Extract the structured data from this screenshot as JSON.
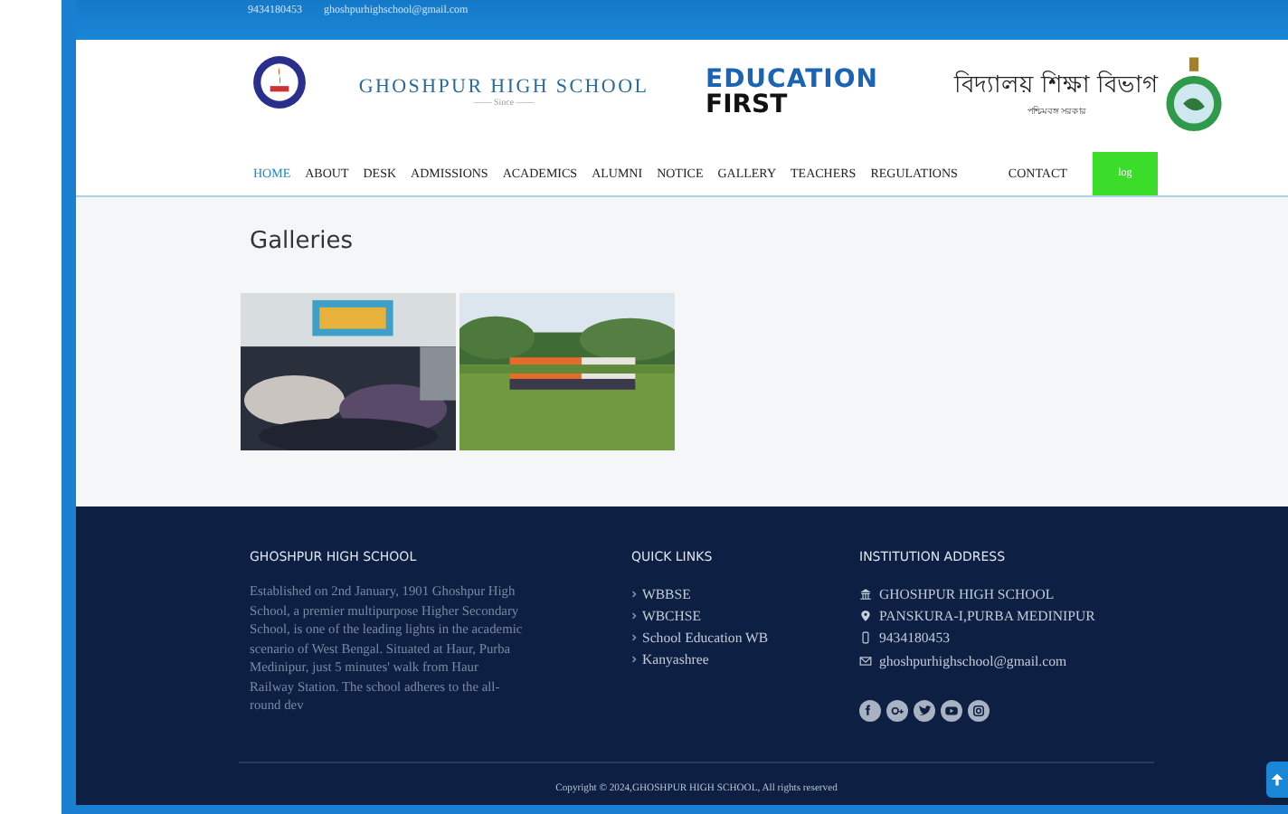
{
  "topbar": {
    "phone": "9434180453",
    "email": "ghoshpurhighschool@gmail.com"
  },
  "header": {
    "school_name": "GHOSHPUR HIGH SCHOOL",
    "since": "—— Since ——",
    "slogan_1": "EDUCATION",
    "slogan_2": "FIRST",
    "dept_name": "বিদ্যালয় শিক্ষা বিভাগ",
    "dept_sub": "পশ্চিমবঙ্গ সরকার"
  },
  "nav": [
    {
      "label": "HOME",
      "selected": true
    },
    {
      "label": "ABOUT",
      "selected": false
    },
    {
      "label": "DESK",
      "selected": false
    },
    {
      "label": "ADMISSIONS",
      "selected": false
    },
    {
      "label": "ACADEMICS",
      "selected": false
    },
    {
      "label": "ALUMNI",
      "selected": false
    },
    {
      "label": "NOTICE",
      "selected": false
    },
    {
      "label": "GALLERY",
      "selected": false
    },
    {
      "label": "TEACHERS",
      "selected": false
    },
    {
      "label": "REGULATIONS",
      "selected": false
    },
    {
      "label": "CONTACT",
      "selected": false
    }
  ],
  "login_button": "log",
  "page_title": "Galleries",
  "footer": {
    "about_title": "GHOSHPUR HIGH SCHOOL",
    "about_text": "Established on 2nd January, 1901 Ghoshpur High School, a premier multipurpose Higher Secondary School, is one of the leading lights in the academic scenario of West Bengal. Situated at Haur, Purba Medinipur, just 5 minutes' walk from Haur Railway Station. The school adheres to the all-round dev",
    "links_title": "QUICK LINKS",
    "links": [
      "WBBSE",
      "WBCHSE",
      "School Education WB",
      "Kanyashree"
    ],
    "address_title": "INSTITUTION ADDRESS",
    "address": [
      {
        "kind": "building",
        "text": "GHOSHPUR HIGH SCHOOL"
      },
      {
        "kind": "pin",
        "text": "PANSKURA-I,PURBA MEDINIPUR"
      },
      {
        "kind": "phone",
        "text": "9434180453"
      },
      {
        "kind": "mail",
        "text": "ghoshpurhighschool@gmail.com"
      }
    ],
    "social": [
      {
        "kind": "facebook"
      },
      {
        "kind": "google"
      },
      {
        "kind": "twitter"
      },
      {
        "kind": "youtube"
      },
      {
        "kind": "instagram"
      }
    ],
    "copyright": "Copyright © 2024,GHOSHPUR HIGH SCHOOL, All rights reserved"
  }
}
